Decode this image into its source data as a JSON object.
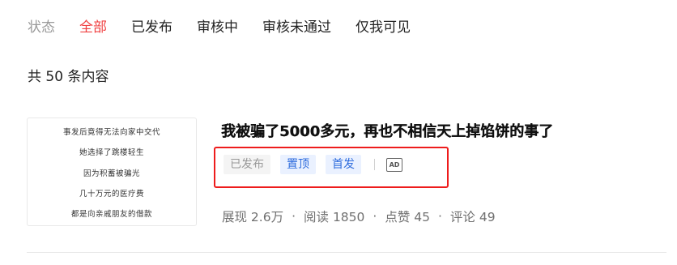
{
  "tabs": {
    "status_label": "状态",
    "items": [
      {
        "label": "全部",
        "active": true
      },
      {
        "label": "已发布"
      },
      {
        "label": "审核中"
      },
      {
        "label": "审核未通过"
      },
      {
        "label": "仅我可见"
      }
    ]
  },
  "summary": "共 50 条内容",
  "article": {
    "thumbnail_lines": [
      "事发后竟得无法向家中交代",
      "她选择了跳楼轻生",
      "因为积蓄被骗光",
      "几十万元的医疗费",
      "都是向亲戚朋友的借款"
    ],
    "title": "我被骗了5000多元，再也不相信天上掉馅饼的事了",
    "tags": {
      "published": "已发布",
      "pin": "置顶",
      "first_publish": "首发",
      "ad_icon": "AD"
    },
    "stats": {
      "views": "展现 2.6万",
      "reads": "阅读 1850",
      "likes": "点赞 45",
      "comments": "评论 49",
      "separator": "·"
    }
  },
  "colors": {
    "active_tab": "#f04142",
    "tag_blue": "#2e6cdd",
    "highlight_border": "#ee1c1c"
  }
}
